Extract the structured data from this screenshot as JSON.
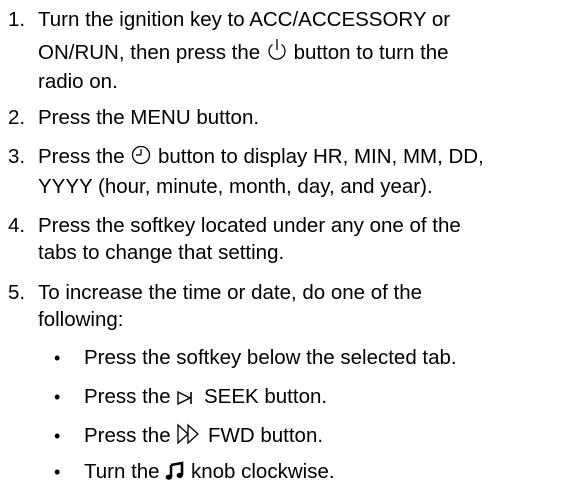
{
  "steps": [
    {
      "num": "1.",
      "lines": [
        "Turn the ignition key to ACC/ACCESSORY or",
        "ON/RUN, then press the ",
        " button to turn the",
        "radio on."
      ]
    },
    {
      "num": "2.",
      "lines": [
        "Press the MENU button."
      ]
    },
    {
      "num": "3.",
      "lines": [
        "Press the ",
        " button to display HR, MIN, MM, DD,",
        "YYYY (hour, minute, month, day, and year)."
      ]
    },
    {
      "num": "4.",
      "lines": [
        "Press the softkey located under any one of the",
        "tabs to change that setting."
      ]
    },
    {
      "num": "5.",
      "lines": [
        "To increase the time or date, do one of the",
        "following:"
      ]
    }
  ],
  "bullets": {
    "b1": {
      "text": "Press the softkey below the selected tab."
    },
    "b2": {
      "pre": "Press the ",
      "post": "  SEEK button."
    },
    "b3": {
      "pre": "Press the ",
      "post": " FWD button."
    },
    "b4": {
      "pre": "Turn the ",
      "post": " knob clockwise."
    }
  },
  "icons": {
    "power": "power-icon",
    "clock": "clock-icon",
    "seek": "seek-next-icon",
    "fwd": "fast-forward-icon",
    "music": "music-note-icon"
  }
}
